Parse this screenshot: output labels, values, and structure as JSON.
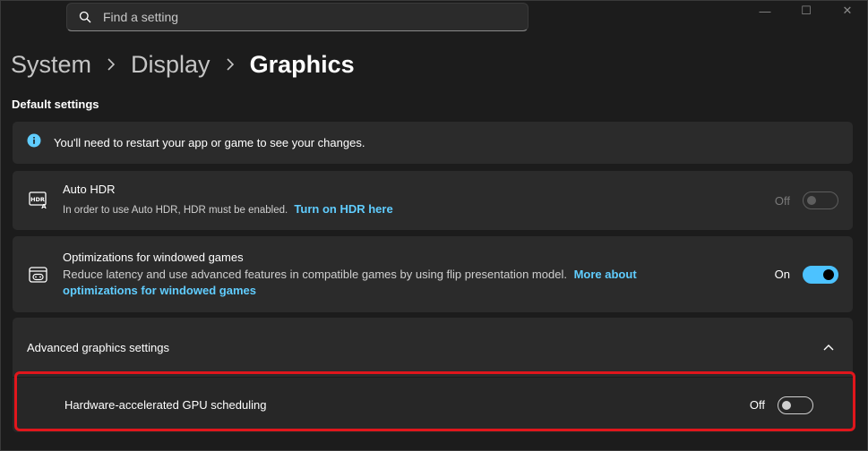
{
  "search": {
    "placeholder": "Find a setting",
    "icon": "search-icon"
  },
  "window_controls": {
    "minimize": "—",
    "maximize": "☐",
    "close": "✕"
  },
  "breadcrumb": {
    "items": [
      "System",
      "Display",
      "Graphics"
    ],
    "separator": "›"
  },
  "section": {
    "title": "Default settings"
  },
  "info": {
    "text": "You'll need to restart your app or game to see your changes.",
    "icon": "info-icon"
  },
  "auto_hdr": {
    "title": "Auto HDR",
    "description": "In order to use Auto HDR, HDR must be enabled.",
    "link": "Turn on HDR here",
    "state_label": "Off",
    "enabled": false,
    "disabled": true,
    "icon": "hdr-icon"
  },
  "windowed_games": {
    "title": "Optimizations for windowed games",
    "description": "Reduce latency and use advanced features in compatible games by using flip presentation model.",
    "link_line1": "More about",
    "link_line2": "optimizations for windowed games",
    "state_label": "On",
    "enabled": true,
    "icon": "game-window-icon"
  },
  "advanced": {
    "title": "Advanced graphics settings",
    "expanded": true,
    "icon": "chevron-up-icon"
  },
  "gpu_scheduling": {
    "title": "Hardware-accelerated GPU scheduling",
    "state_label": "Off",
    "enabled": false
  },
  "colors": {
    "accent": "#4cc2ff",
    "link": "#60cdff",
    "highlight": "#e0161c",
    "background": "#1c1c1c",
    "card": "#2b2b2b"
  }
}
